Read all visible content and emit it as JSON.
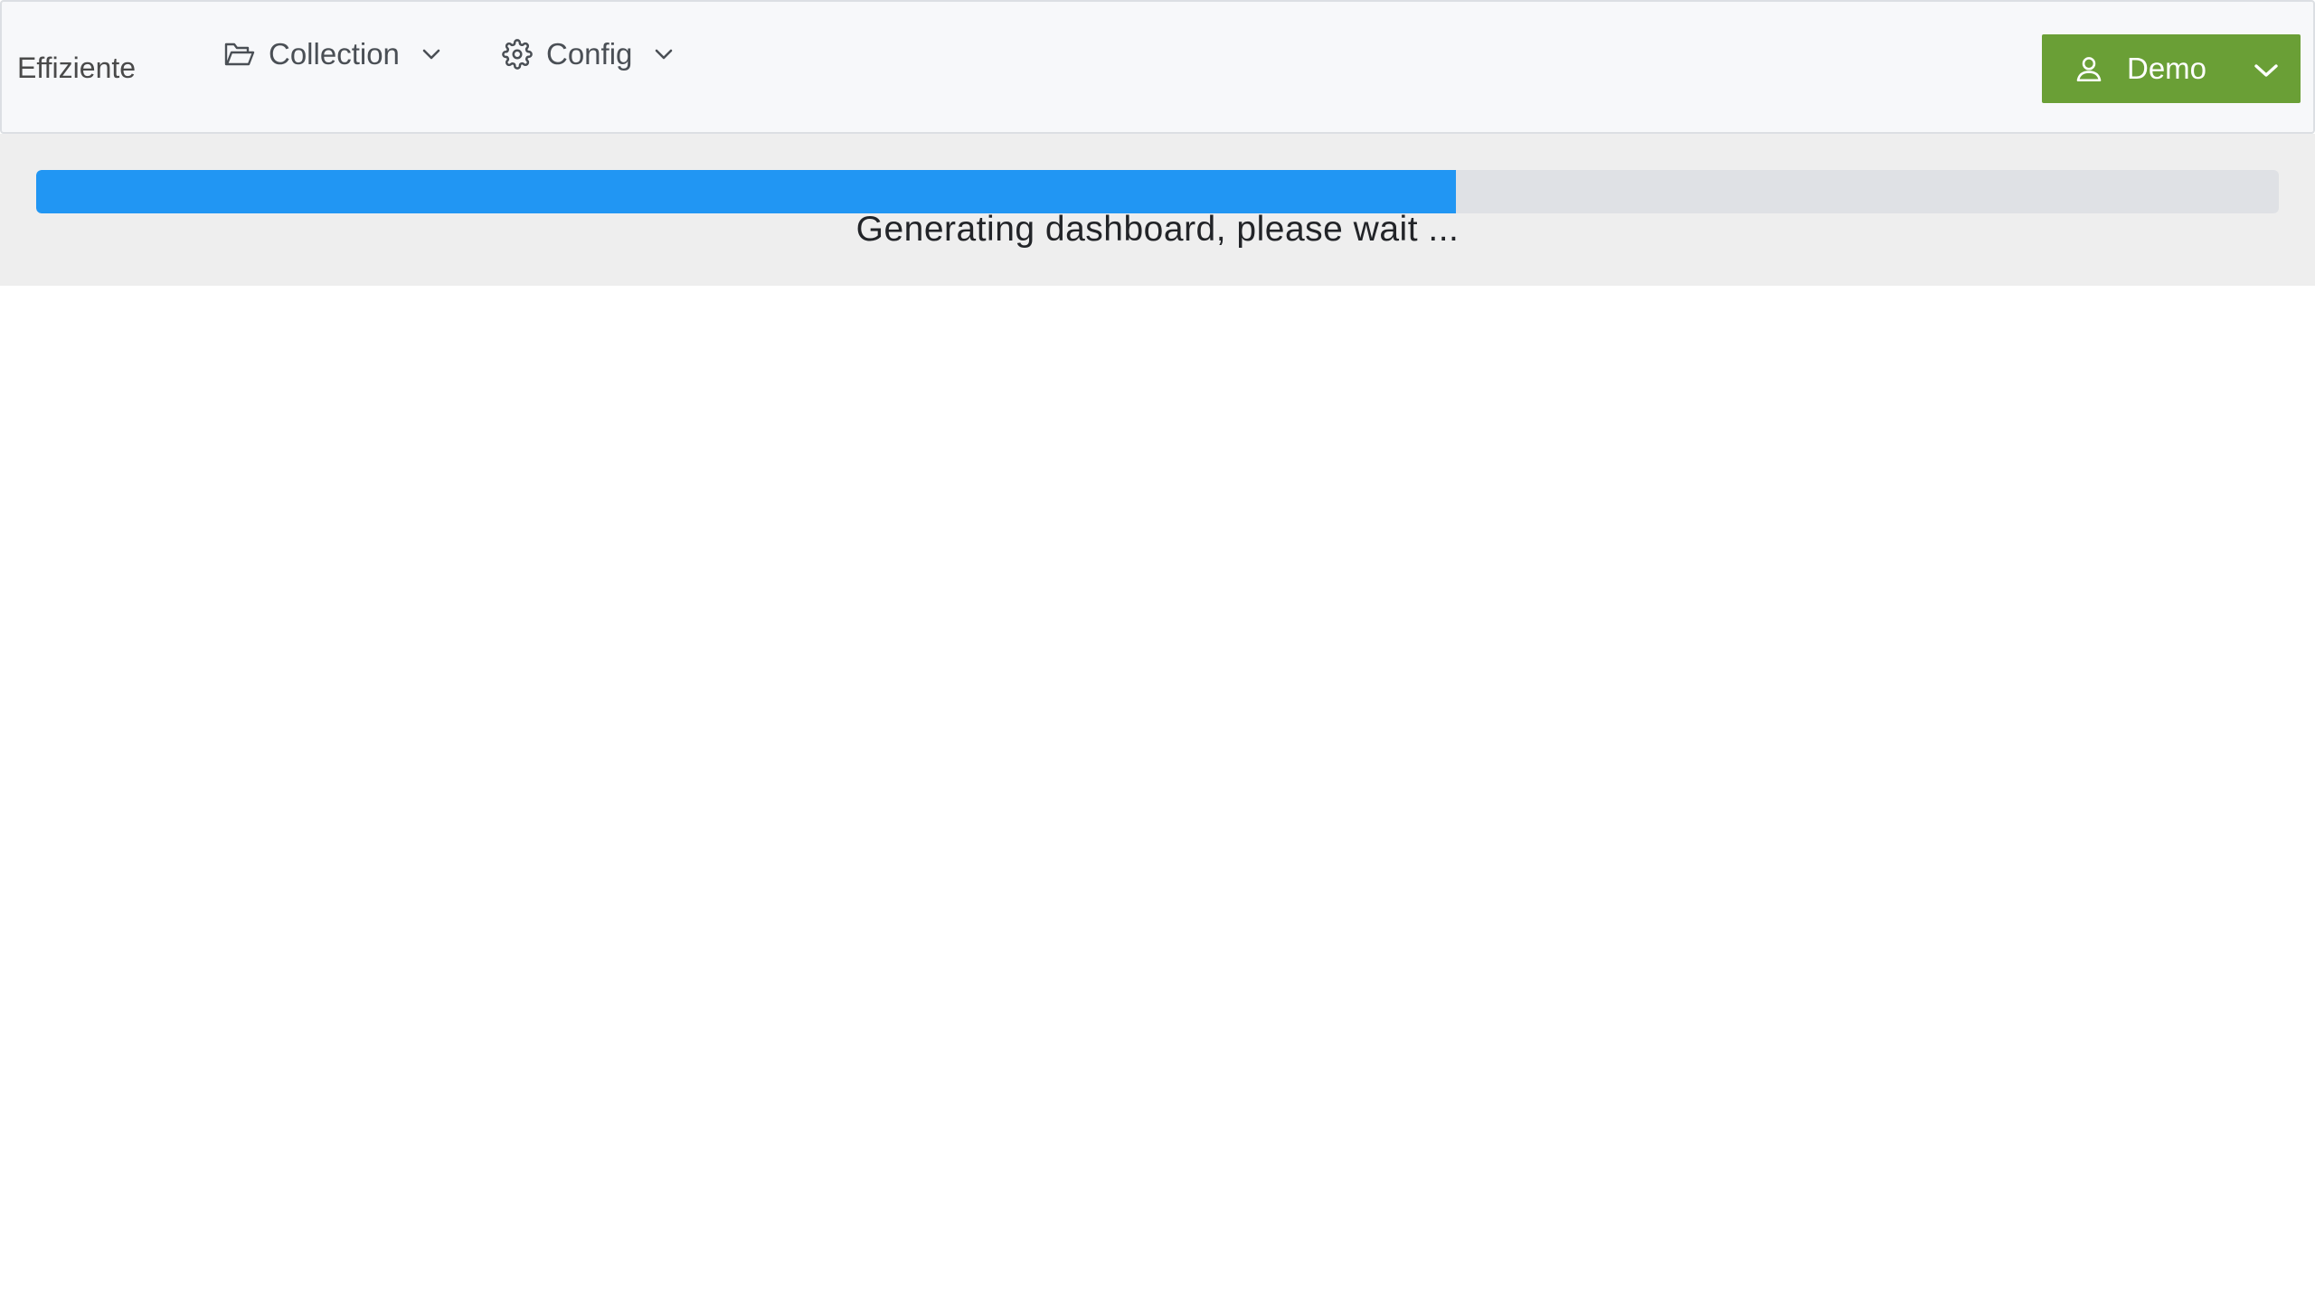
{
  "navbar": {
    "brand": "Effiziente",
    "items": [
      {
        "label": "Collection",
        "icon": "folder-open-icon"
      },
      {
        "label": "Config",
        "icon": "gear-icon"
      }
    ],
    "user": {
      "label": "Demo",
      "icon": "user-icon",
      "color": "#6a9f36"
    }
  },
  "loading": {
    "progress": 0.633,
    "message": "Generating dashboard, please wait ...",
    "bar_color": "#2196f3"
  }
}
